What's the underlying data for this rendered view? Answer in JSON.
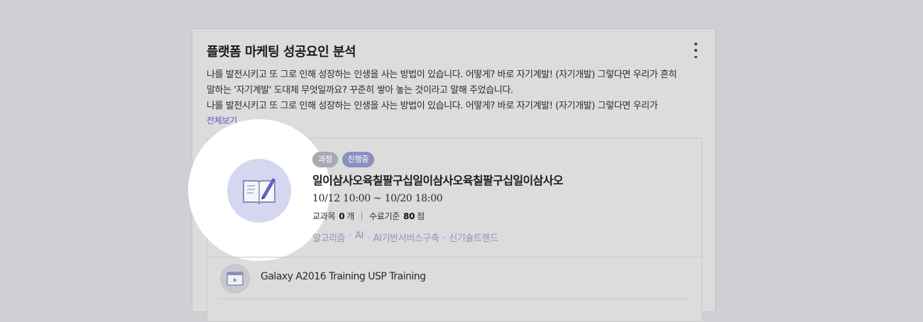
{
  "panel": {
    "title": "플랫폼 마케팅 성공요인 분석",
    "more_icon": "more-vertical-icon",
    "description_lines": [
      "나를 발전시키고 또 그로 인해 성장하는 인생을 사는 방법이 있습니다. 어떻게? 바로 자기계발! (자기개발) 그렇다면 우리가 흔히",
      "말하는 '자기계발' 도대체 무엇일까요? 꾸준히 쌓아 놓는 것이라고 말해 주었습니다.",
      "나를 발전시키고 또 그로 인해 성장하는 인생을 사는 방법이 있습니다. 어떻게? 바로 자기계발! (자기개발) 그렇다면 우리가"
    ],
    "view_all": "전체보기"
  },
  "course_card": {
    "thumbnail_icon": "book-pencil-icon",
    "badges": {
      "type": "과정",
      "status": "진행중"
    },
    "title": "일이삼사오육칠팔구십일이삼사오육칠팔구십일이삼사오",
    "period": "10/12 10:00 ~ 10/20 18:00",
    "subject_label": "교과목",
    "subject_count": "0",
    "subject_unit": "개",
    "completion_label": "수료기준",
    "completion_score": "80",
    "completion_unit": "점",
    "tags": [
      "알고리즘",
      "AI",
      "AI기반서비스구축",
      "신기술트렌드"
    ]
  },
  "sub_item": {
    "icon": "video-player-icon",
    "title": "Galaxy A2016 Training USP Training"
  },
  "colors": {
    "background": "#cfd0d3",
    "panel": "#dcdcdc",
    "link": "#5b5bb8",
    "badge_course": "#a6aab4",
    "badge_progress": "#8b8fc2",
    "tag_text": "#8f93b8"
  }
}
